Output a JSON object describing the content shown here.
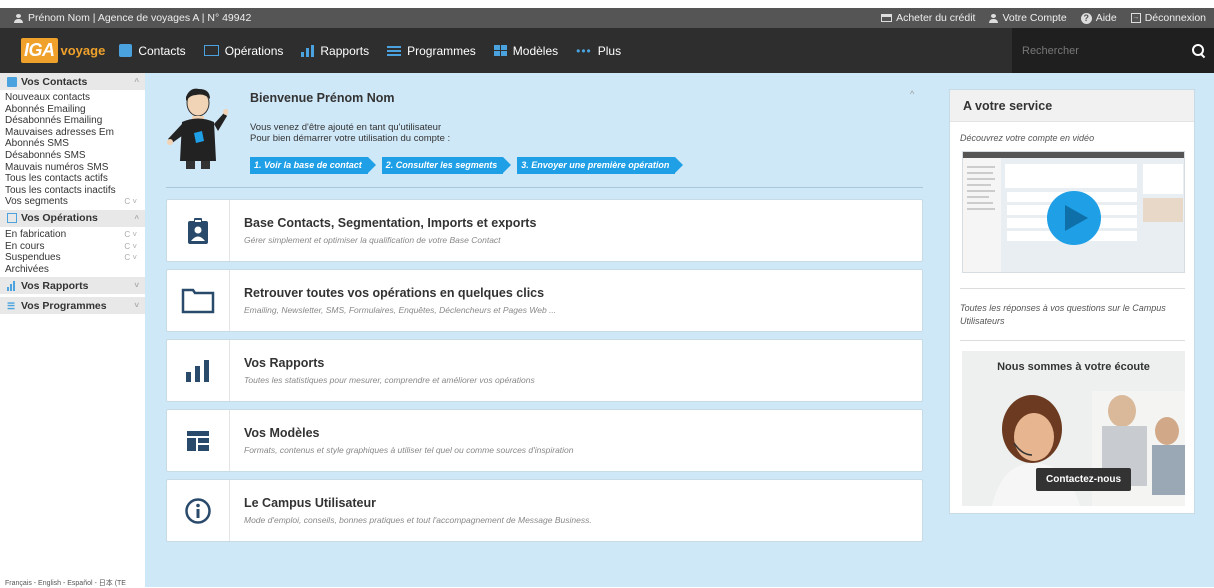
{
  "topbar": {
    "user_info": "Prénom Nom | Agence de voyages A | N° 49942",
    "buy_credit": "Acheter du crédit",
    "account": "Votre Compte",
    "help": "Aide",
    "logout": "Déconnexion"
  },
  "brand": {
    "logo_mark": "IGA",
    "logo_text": "voyage"
  },
  "nav": {
    "items": [
      {
        "label": "Contacts",
        "icon": "contact-card-icon"
      },
      {
        "label": "Opérations",
        "icon": "folder-icon"
      },
      {
        "label": "Rapports",
        "icon": "bar-chart-icon"
      },
      {
        "label": "Programmes",
        "icon": "list-icon"
      },
      {
        "label": "Modèles",
        "icon": "template-grid-icon"
      },
      {
        "label": "Plus",
        "icon": "more-dots-icon"
      }
    ],
    "search_placeholder": "Rechercher"
  },
  "sidebar": {
    "contacts_title": "Vos Contacts",
    "contacts_items": [
      "Nouveaux contacts",
      "Abonnés Emailing",
      "Désabonnés Emailing",
      "Mauvaises adresses Em",
      "Abonnés SMS",
      "Désabonnés SMS",
      "Mauvais numéros SMS",
      "Tous les contacts actifs",
      "Tous les contacts inactifs",
      "Vos segments"
    ],
    "operations_title": "Vos Opérations",
    "operations_items": [
      "En fabrication",
      "En cours",
      "Suspendues",
      "Archivées"
    ],
    "reports_title": "Vos Rapports",
    "programs_title": "Vos Programmes",
    "footer_lang": "Français - English - Español - 日本 (TE"
  },
  "welcome": {
    "title": "Bienvenue Prénom Nom",
    "line1": "Vous venez d'être ajouté en tant qu'utilisateur",
    "line2": "Pour bien démarrer votre utilisation du compte :",
    "steps": [
      "1. Voir la base de contact",
      "2. Consulter les segments",
      "3. Envoyer une première opération"
    ]
  },
  "cards": [
    {
      "title": "Base Contacts, Segmentation, Imports et exports",
      "subtitle": "Gérer simplement et optimiser la qualification de votre Base Contact",
      "icon": "contact-badge-icon"
    },
    {
      "title": "Retrouver toutes vos opérations en quelques clics",
      "subtitle": "Emailing, Newsletter, SMS, Formulaires, Enquêtes, Déclencheurs et Pages Web ...",
      "icon": "folder-icon"
    },
    {
      "title": "Vos Rapports",
      "subtitle": "Toutes les statistiques pour mesurer, comprendre et améliorer vos opérations",
      "icon": "bar-chart-icon"
    },
    {
      "title": "Vos Modèles",
      "subtitle": "Formats, contenus et style graphiques à utiliser tel quel ou comme sources d'inspiration",
      "icon": "template-grid-icon"
    },
    {
      "title": "Le Campus Utilisateur",
      "subtitle": "Mode d'emploi, conseils, bonnes pratiques et tout l'accompagnement de Message Business.",
      "icon": "info-circle-icon"
    }
  ],
  "service": {
    "title": "A votre service",
    "video_label": "Découvrez votre compte en vidéo",
    "faq": "Toutes les réponses à vos questions sur le Campus Utilisateurs",
    "listen_title": "Nous sommes à votre écoute",
    "contact_button": "Contactez-nous"
  },
  "colors": {
    "accent": "#4aa3df",
    "step_blue": "#1e9fe6",
    "brand_orange": "#f0a12b",
    "main_bg": "#cfe8f8",
    "icon_dark": "#2a4a6b"
  }
}
